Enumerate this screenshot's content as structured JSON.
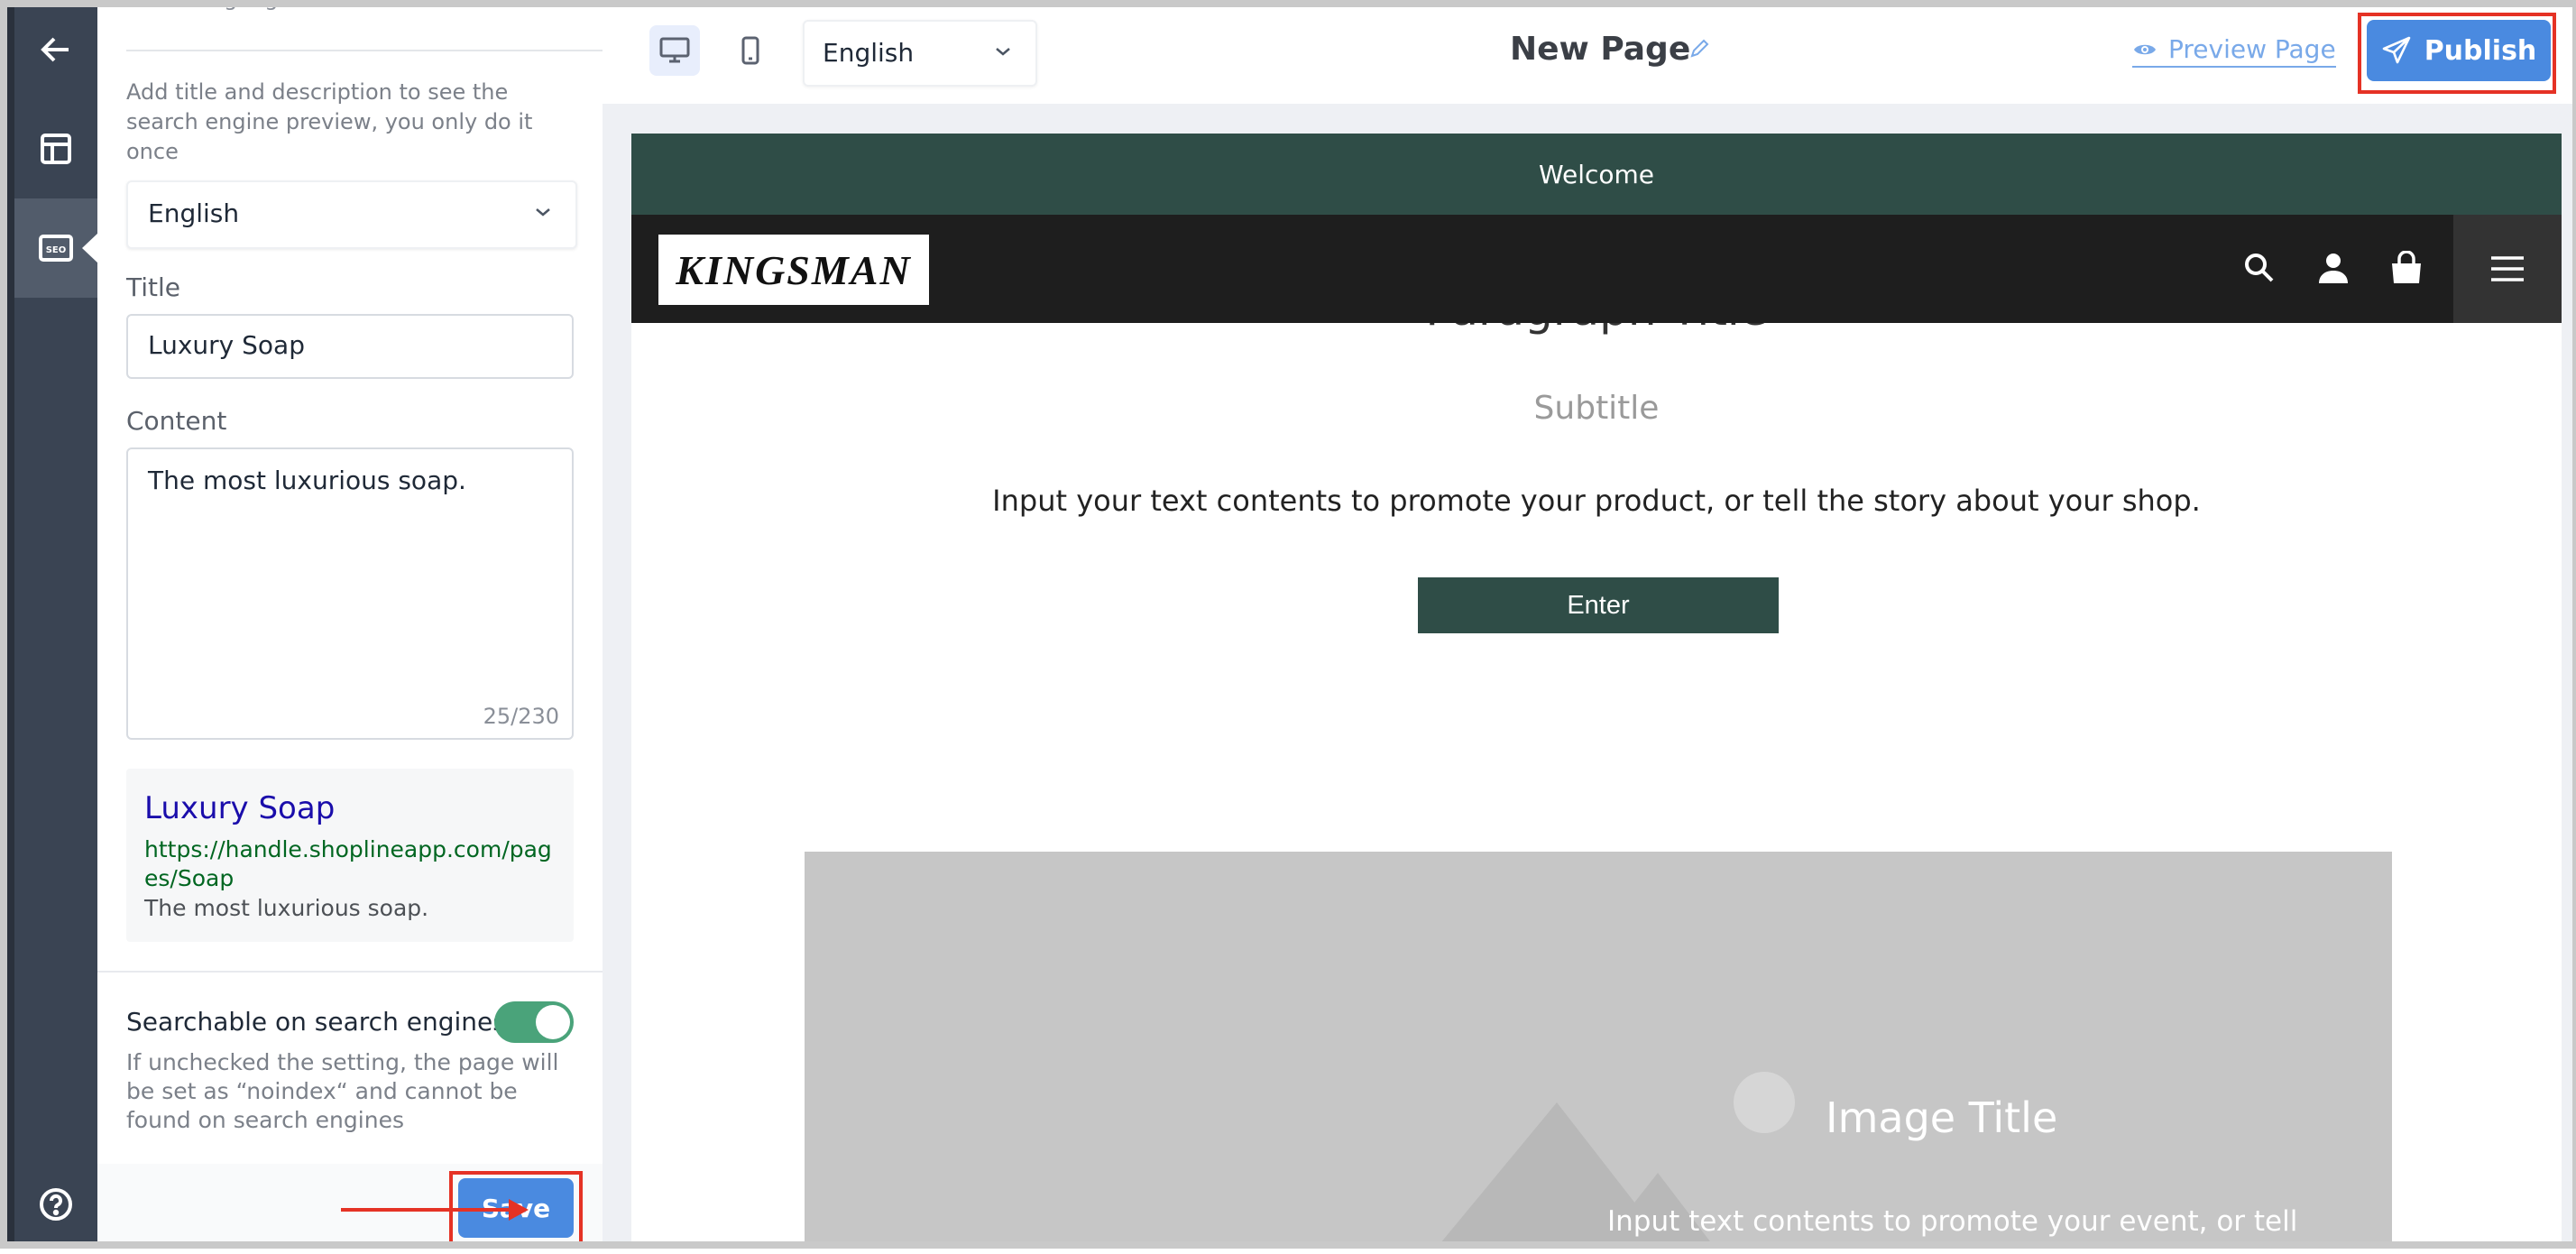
{
  "seo_panel": {
    "truncated_heading": "other languages",
    "description": "Add title and description to see the search engine preview, you only do it once",
    "language_select": "English",
    "title_label": "Title",
    "title_value": "Luxury Soap",
    "content_label": "Content",
    "content_value": "The most luxurious soap.",
    "char_count": "25/230",
    "preview": {
      "title": "Luxury Soap",
      "url": "https://handle.shoplineapp.com/pages/Soap",
      "description": "The most luxurious soap."
    },
    "searchable_label": "Searchable on search engines",
    "searchable_on": true,
    "searchable_hint": "If unchecked the setting, the page will be set as “noindex“ and cannot be found on search engines",
    "save_label": "Save"
  },
  "toolbar": {
    "language": "English",
    "page_title": "New Page",
    "preview_label": "Preview Page",
    "publish_label": "Publish"
  },
  "canvas": {
    "banner": "Welcome",
    "logo_text": "KINGSMAN",
    "paragraph_title": "Paragraph Title",
    "subtitle": "Subtitle",
    "body_text": "Input your text contents to promote your product, or tell the story about your shop.",
    "enter_label": "Enter",
    "image_title": "Image Title",
    "image_text": "Input text contents to promote your event, or tell"
  },
  "colors": {
    "rail": "#3a4453",
    "accent": "#4a8ae0",
    "theme_green": "#2f4d47",
    "toggle_on": "#4aa37a",
    "annotation_red": "#e53225"
  },
  "icons": [
    "back-arrow-icon",
    "layout-icon",
    "seo-icon",
    "help-icon",
    "desktop-icon",
    "mobile-icon",
    "chevron-down-icon",
    "pencil-icon",
    "eye-icon",
    "paper-plane-icon",
    "search-icon",
    "user-icon",
    "shopping-bag-icon",
    "hamburger-menu-icon"
  ]
}
